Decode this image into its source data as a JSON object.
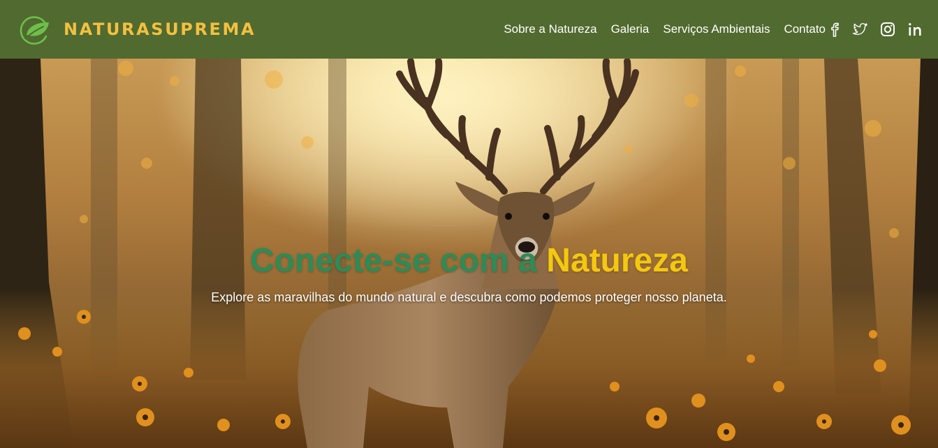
{
  "brand": {
    "name": "NATURASUPREMA",
    "logo_icon": "leaf-circle-icon",
    "colors": {
      "logo_green": "#6cc04a",
      "name_yellow": "#f2c041"
    }
  },
  "nav": {
    "background": "#516a2f",
    "links": [
      {
        "label": "Sobre a Natureza"
      },
      {
        "label": "Galeria"
      },
      {
        "label": "Serviços Ambientais"
      },
      {
        "label": "Contato"
      }
    ],
    "social": [
      {
        "icon": "facebook-icon"
      },
      {
        "icon": "twitter-icon"
      },
      {
        "icon": "instagram-icon"
      },
      {
        "icon": "linkedin-icon"
      }
    ]
  },
  "hero": {
    "background_image": "deer-in-forest-photo",
    "title_part1": "Conecte-se com a ",
    "title_part2": "Natureza",
    "subtitle": "Explore as maravilhas do mundo natural e descubra como podemos proteger nosso planeta.",
    "colors": {
      "title_green": "#2e8b57",
      "title_accent": "#f4c80e",
      "subtitle": "#ffffff"
    }
  }
}
